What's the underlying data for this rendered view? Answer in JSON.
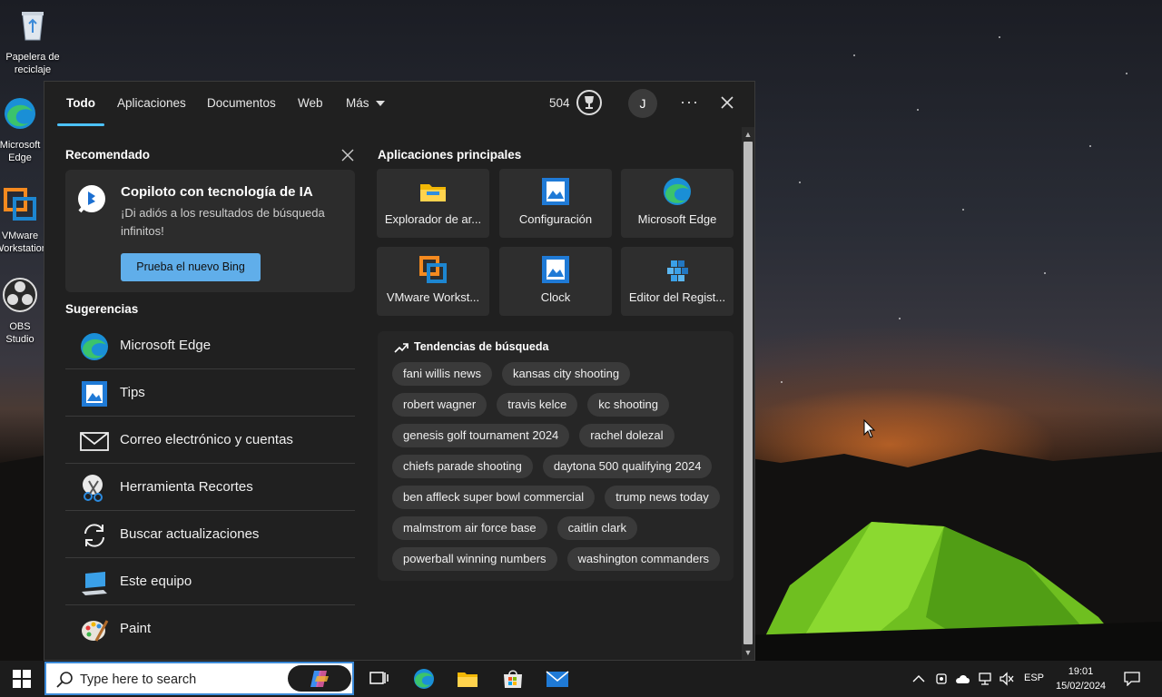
{
  "desktop": {
    "icons": [
      {
        "label": "Papelera de reciclaje"
      },
      {
        "label": "Microsoft Edge"
      },
      {
        "label": "VMware Workstation"
      },
      {
        "label": "OBS Studio"
      }
    ]
  },
  "search_panel": {
    "tabs": [
      {
        "label": "Todo",
        "active": true
      },
      {
        "label": "Aplicaciones"
      },
      {
        "label": "Documentos"
      },
      {
        "label": "Web"
      },
      {
        "label": "Más"
      }
    ],
    "points": "504",
    "avatar_initial": "J",
    "more_label": "···",
    "recommended": {
      "title": "Recomendado",
      "card_title": "Copiloto con tecnología de IA",
      "card_desc": "¡Di adiós a los resultados de búsqueda infinitos!",
      "button": "Prueba el nuevo Bing"
    },
    "suggestions": {
      "title": "Sugerencias",
      "items": [
        {
          "label": "Microsoft Edge",
          "icon": "edge-icon"
        },
        {
          "label": "Tips",
          "icon": "tips-icon"
        },
        {
          "label": "Correo electrónico y cuentas",
          "icon": "mail-icon"
        },
        {
          "label": "Herramienta Recortes",
          "icon": "snipping-tool-icon"
        },
        {
          "label": "Buscar actualizaciones",
          "icon": "update-icon"
        },
        {
          "label": "Este equipo",
          "icon": "this-pc-icon"
        },
        {
          "label": "Paint",
          "icon": "paint-icon"
        }
      ]
    },
    "top_apps": {
      "title": "Aplicaciones principales",
      "items": [
        {
          "label": "Explorador de ar...",
          "icon": "folder-icon"
        },
        {
          "label": "Configuración",
          "icon": "settings-app-icon"
        },
        {
          "label": "Microsoft Edge",
          "icon": "edge-icon"
        },
        {
          "label": "VMware Workst...",
          "icon": "vmware-icon"
        },
        {
          "label": "Clock",
          "icon": "clock-app-icon"
        },
        {
          "label": "Editor del Regist...",
          "icon": "registry-icon"
        }
      ]
    },
    "trends": {
      "title": "Tendencias de búsqueda",
      "items": [
        "fani willis news",
        "kansas city shooting",
        "robert wagner",
        "travis kelce",
        "kc shooting",
        "genesis golf tournament 2024",
        "rachel dolezal",
        "chiefs parade shooting",
        "daytona 500 qualifying 2024",
        "ben affleck super bowl commercial",
        "trump news today",
        "malmstrom air force base",
        "caitlin clark",
        "powerball winning numbers",
        "washington commanders"
      ]
    }
  },
  "taskbar": {
    "search_placeholder": "Type here to search",
    "language": "ESP",
    "time": "19:01",
    "date": "15/02/2024"
  },
  "colors": {
    "accent": "#4cc2ff",
    "button": "#60aeea",
    "panel_bg": "#202020"
  }
}
